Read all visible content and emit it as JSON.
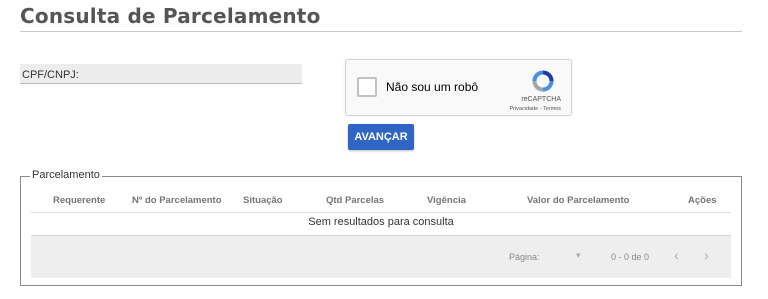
{
  "page": {
    "title": "Consulta de Parcelamento"
  },
  "form": {
    "cpf_label": "CPF/CNPJ:",
    "captcha": {
      "label": "Não sou um robô",
      "brand": "reCAPTCHA",
      "terms": "Privacidade - Termos"
    },
    "submit_label": "AVANÇAR"
  },
  "results": {
    "legend": "Parcelamento",
    "columns": [
      "Requerente",
      "Nº do Parcelamento",
      "Situação",
      "Qtd Parcelas",
      "Vigência",
      "Valor do Parcelamento",
      "Ações"
    ],
    "empty_message": "Sem resultados para consulta",
    "pagination": {
      "page_label": "Página:",
      "range": "0 - 0 de 0",
      "select_icon": "caret-down-icon",
      "prev_icon": "chevron-left-icon",
      "next_icon": "chevron-right-icon"
    }
  },
  "colors": {
    "button": "#2f65c4",
    "field_bg": "#ececec",
    "footer_bg": "#eeeeee"
  }
}
